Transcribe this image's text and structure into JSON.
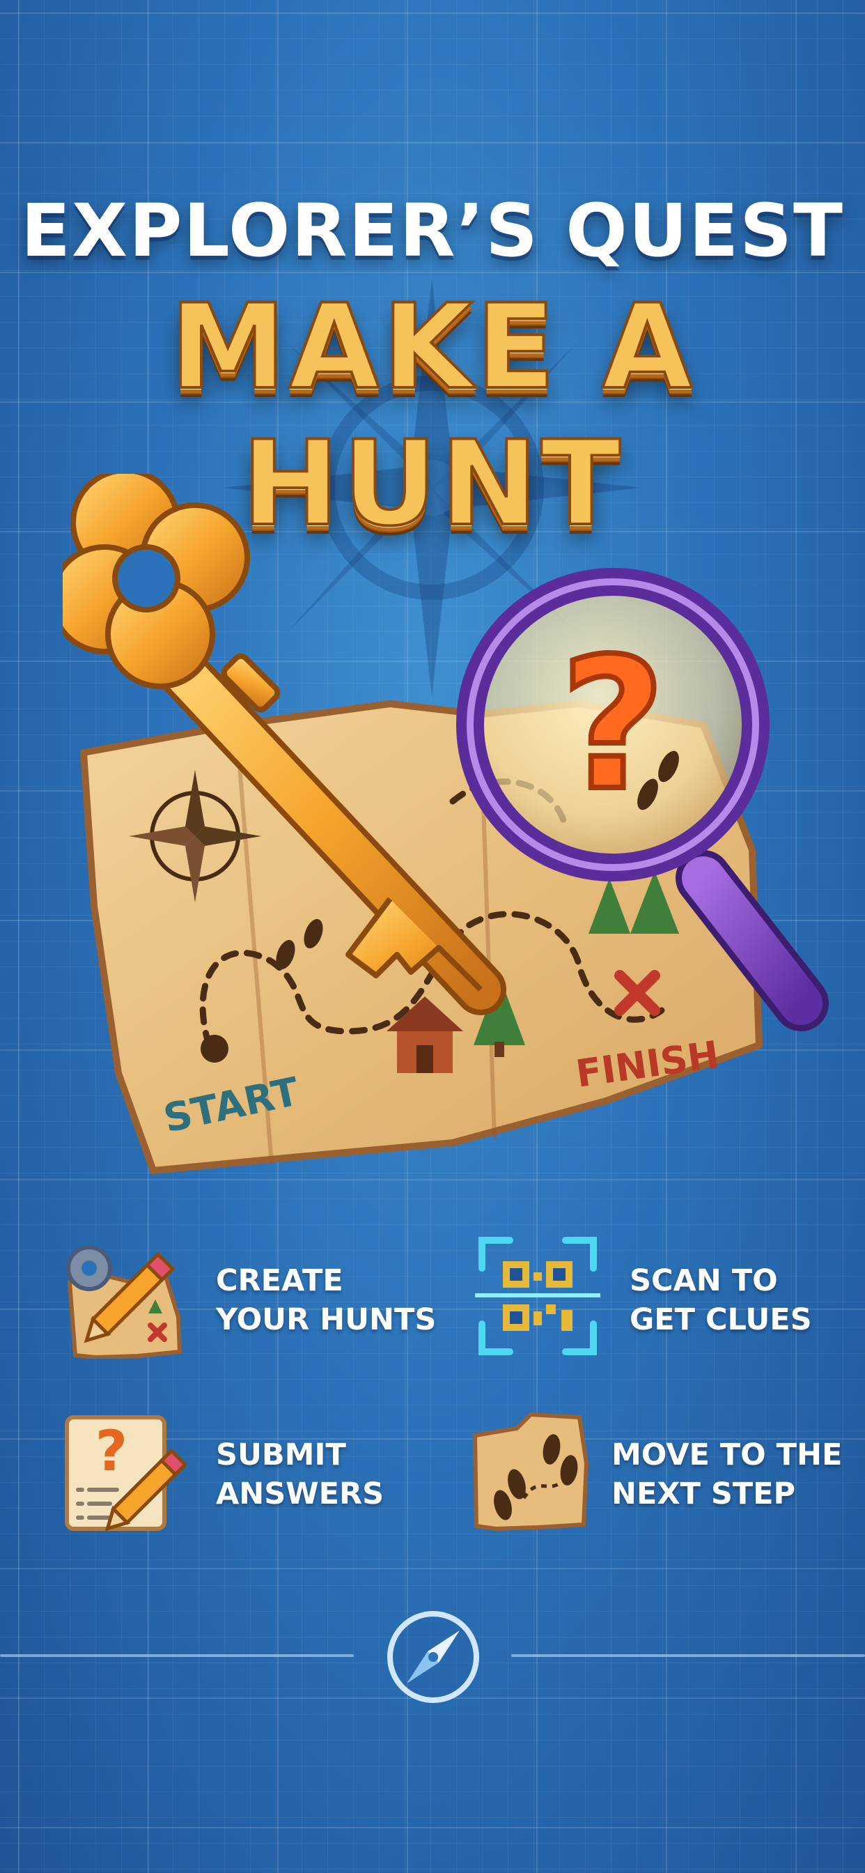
{
  "header": {
    "subtitle": "EXPLORER’S QUEST",
    "title": "MAKE A HUNT"
  },
  "map": {
    "start_label": "START",
    "finish_label": "FINISH",
    "clue_symbol": "?"
  },
  "features": [
    {
      "icon": "create-hunt-icon",
      "line1": "CREATE",
      "line2": "YOUR HUNTS"
    },
    {
      "icon": "qr-scan-icon",
      "line1": "SCAN TO",
      "line2": "GET CLUES"
    },
    {
      "icon": "submit-answers-icon",
      "line1": "SUBMIT",
      "line2": "ANSWERS"
    },
    {
      "icon": "next-step-map-icon",
      "line1": "MOVE TO THE",
      "line2": "NEXT STEP"
    }
  ],
  "bottom": {
    "icon": "compass-icon"
  },
  "colors": {
    "background": "#2c72b8",
    "gold": "#f6c35a",
    "map_paper": "#e9c48a",
    "lens_purple": "#8a4fd0",
    "question_orange": "#ff6a1f",
    "finish_red": "#c0392b",
    "start_teal": "#2e6f7d"
  }
}
